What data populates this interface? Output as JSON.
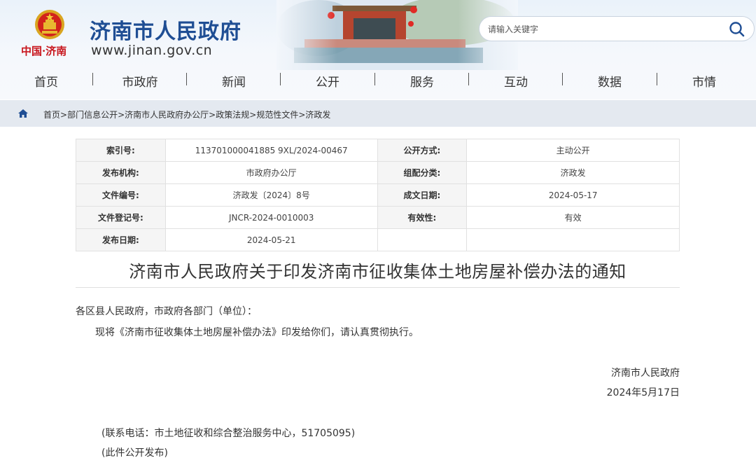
{
  "header": {
    "emblem_icon": "national-emblem-icon",
    "cn_tag": "中国·济南",
    "site_title": "济南市人民政府",
    "site_url": "www.jinan.gov.cn",
    "search": {
      "placeholder": "请输入关键字",
      "icon": "search-icon"
    }
  },
  "nav": {
    "items": [
      "首页",
      "市政府",
      "新闻",
      "公开",
      "服务",
      "互动",
      "数据",
      "市情"
    ]
  },
  "breadcrumb": {
    "home_icon": "home-icon",
    "items": [
      "首页",
      "部门信息公开",
      "济南市人民政府办公厅",
      "政策法规",
      "规范性文件",
      "济政发"
    ],
    "separator": ">"
  },
  "meta": {
    "rows": [
      {
        "l1": "索引号:",
        "v1": "113701000041885 9XL/2024-00467",
        "l2": "公开方式:",
        "v2": "主动公开"
      },
      {
        "l1": "发布机构:",
        "v1": "市政府办公厅",
        "l2": "组配分类:",
        "v2": "济政发"
      },
      {
        "l1": "文件编号:",
        "v1": "济政发〔2024〕8号",
        "l2": "成文日期:",
        "v2": "2024-05-17"
      },
      {
        "l1": "文件登记号:",
        "v1": "JNCR-2024-0010003",
        "l2": "有效性:",
        "v2": "有效"
      },
      {
        "l1": "发布日期:",
        "v1": "2024-05-21"
      }
    ]
  },
  "document": {
    "title": "济南市人民政府关于印发济南市征收集体土地房屋补偿办法的通知",
    "addressee": "各区县人民政府，市政府各部门（单位）：",
    "paragraph": "现将《济南市征收集体土地房屋补偿办法》印发给你们，请认真贯彻执行。",
    "issuer": "济南市人民政府",
    "issue_date": "2024年5月17日",
    "contact": "(联系电话：市土地征收和综合整治服务中心，51705095)",
    "publish_note": "(此件公开发布)"
  },
  "colors": {
    "brand_blue": "#1f4e94",
    "brand_red": "#c8161d",
    "breadcrumb_bg": "#e4e9f0"
  }
}
